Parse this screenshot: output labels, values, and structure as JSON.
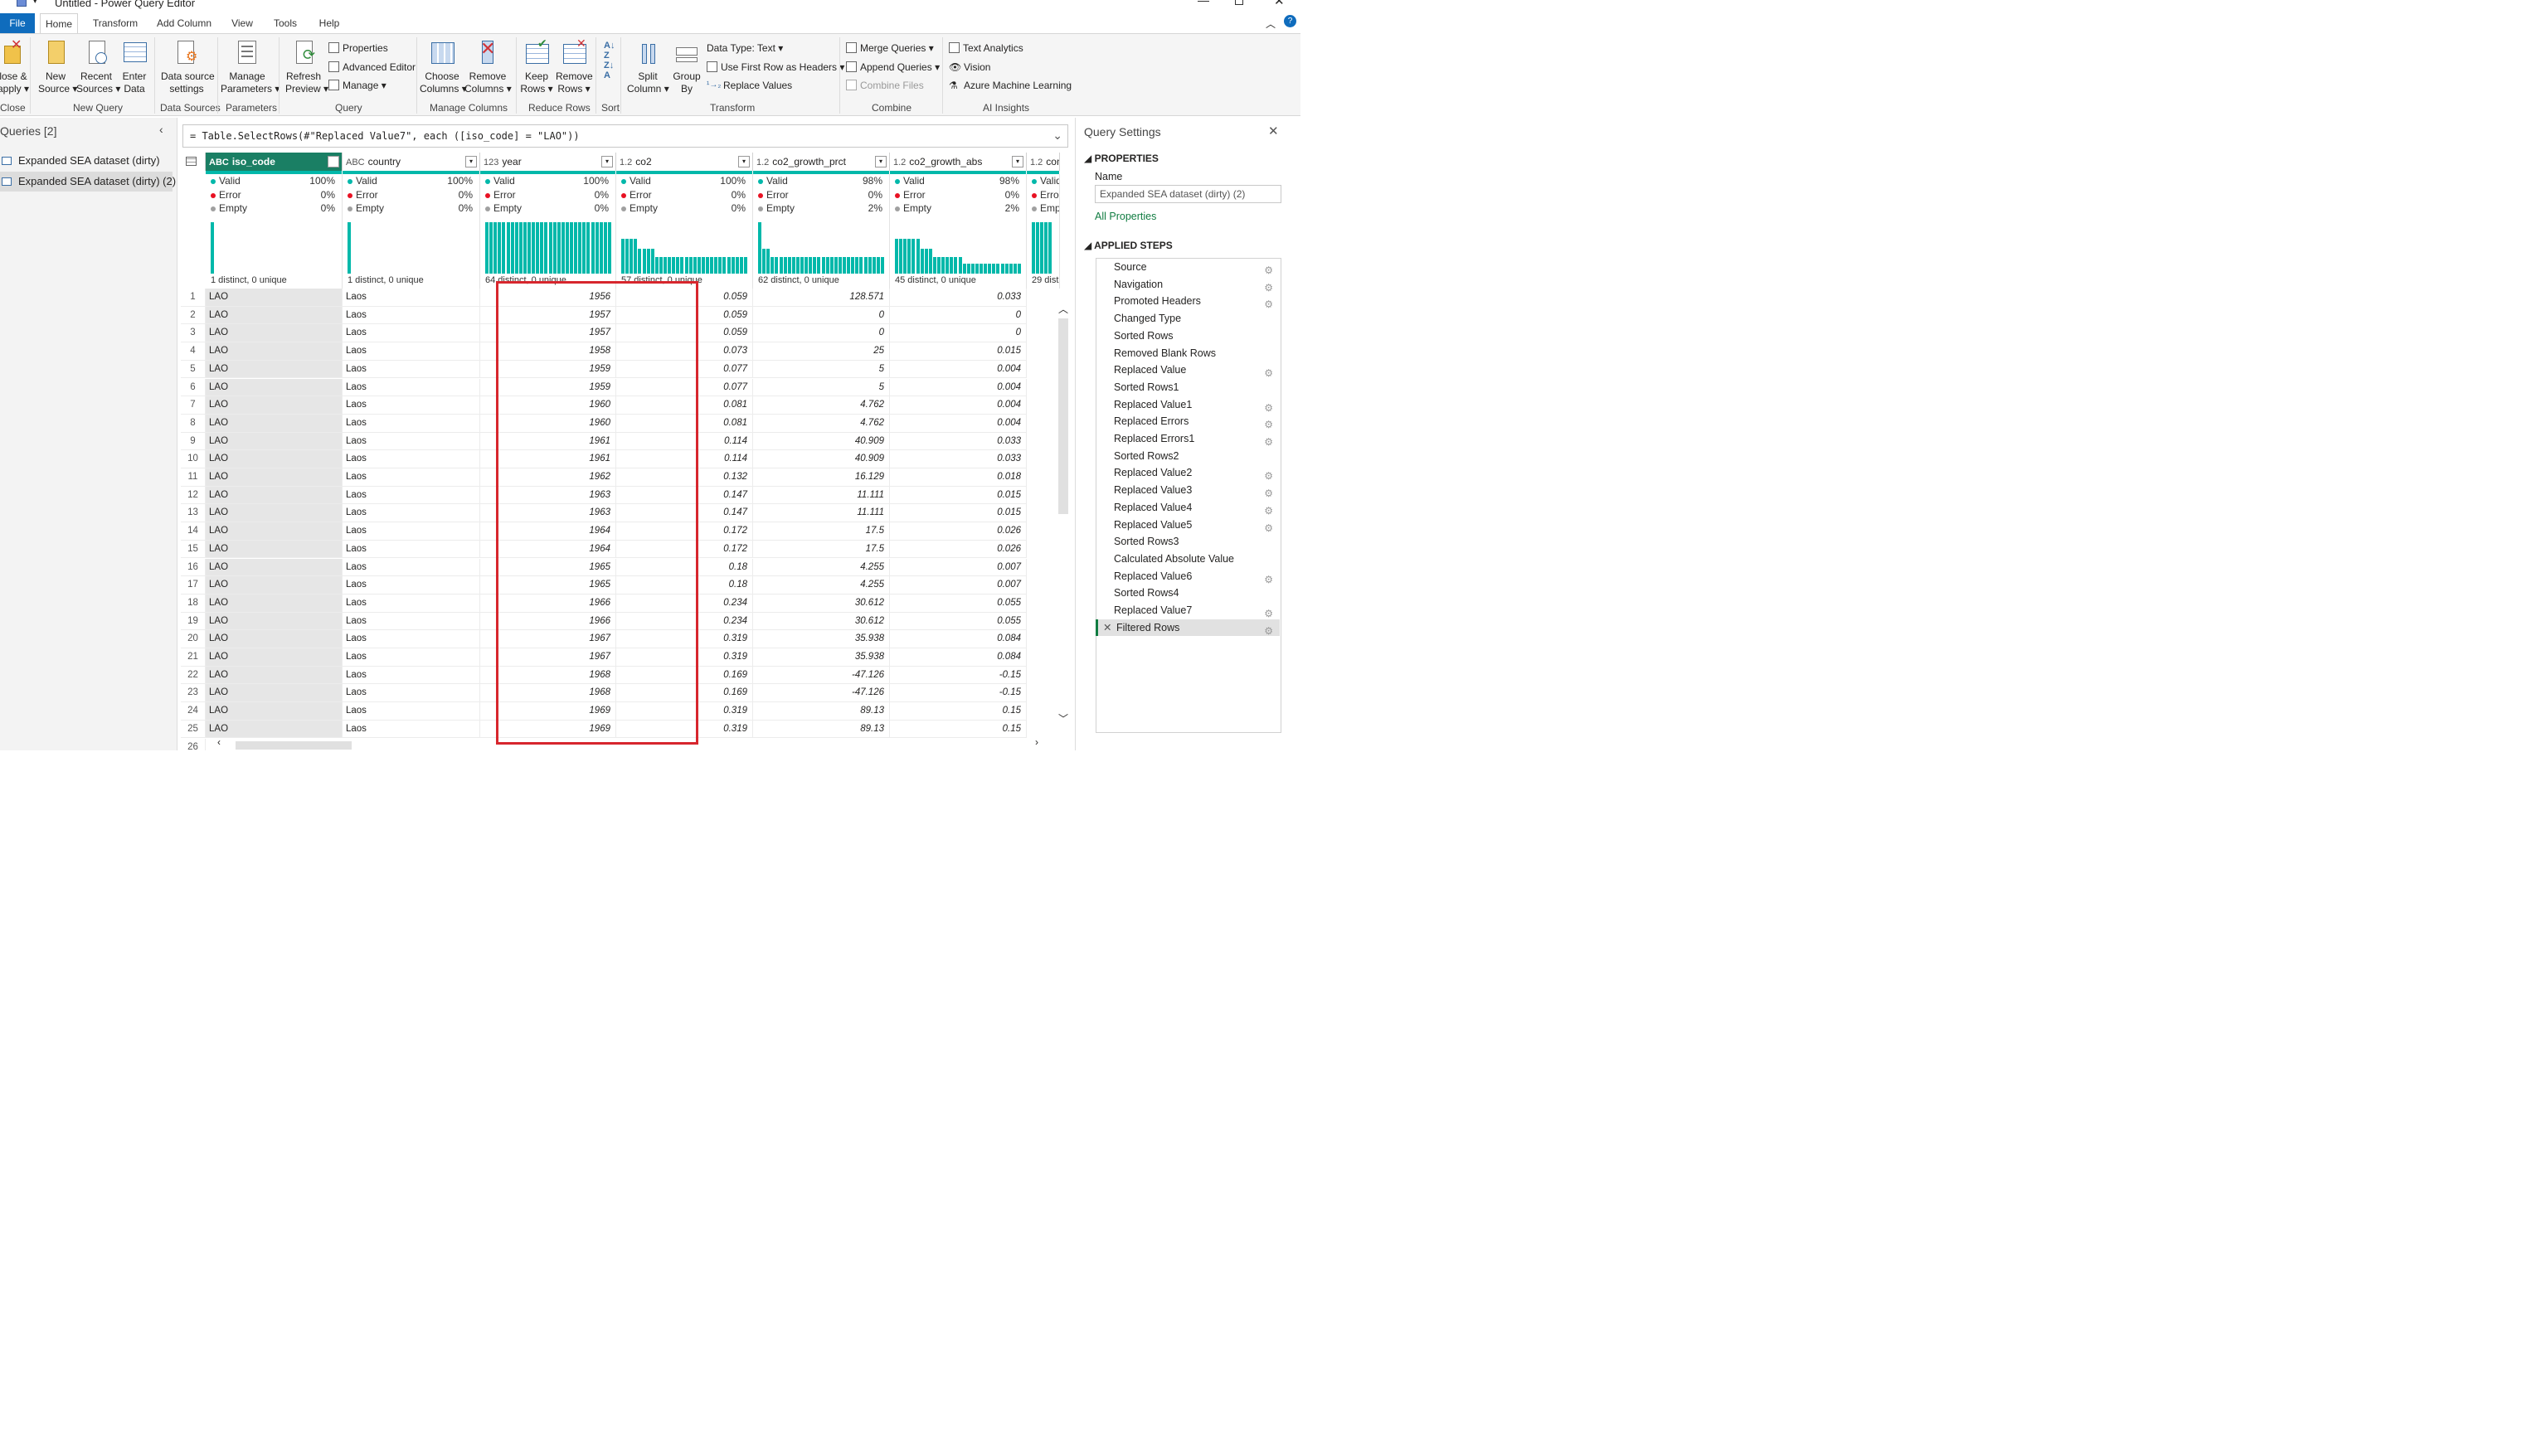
{
  "window": {
    "title": "Untitled - Power Query Editor"
  },
  "tabs": [
    "File",
    "Home",
    "Transform",
    "Add Column",
    "View",
    "Tools",
    "Help"
  ],
  "ribbon": {
    "close": {
      "buttons": [
        {
          "label": "lose &",
          "label2": "apply"
        }
      ],
      "group": "Close"
    },
    "new_query": {
      "buttons": [
        {
          "label": "New",
          "label2": "Source"
        },
        {
          "label": "Recent",
          "label2": "Sources"
        },
        {
          "label": "Enter",
          "label2": "Data"
        }
      ],
      "group": "New Query"
    },
    "data_sources": {
      "buttons": [
        {
          "label": "Data source",
          "label2": "settings"
        }
      ],
      "group": "Data Sources"
    },
    "parameters": {
      "buttons": [
        {
          "label": "Manage",
          "label2": "Parameters"
        }
      ],
      "group": "Parameters"
    },
    "query": {
      "buttons": [
        {
          "label": "Refresh",
          "label2": "Preview"
        }
      ],
      "small": [
        "Properties",
        "Advanced Editor",
        "Manage"
      ],
      "group": "Query"
    },
    "manage_columns": {
      "buttons": [
        {
          "label": "Choose",
          "label2": "Columns"
        },
        {
          "label": "Remove",
          "label2": "Columns"
        }
      ],
      "group": "Manage Columns"
    },
    "reduce_rows": {
      "buttons": [
        {
          "label": "Keep",
          "label2": "Rows"
        },
        {
          "label": "Remove",
          "label2": "Rows"
        }
      ],
      "group": "Reduce Rows"
    },
    "sort": {
      "group": "Sort"
    },
    "transform": {
      "buttons": [
        {
          "label": "Split",
          "label2": "Column"
        },
        {
          "label": "Group",
          "label2": "By"
        }
      ],
      "small": [
        "Data Type: Text",
        "Use First Row as Headers",
        "Replace Values"
      ],
      "group": "Transform"
    },
    "combine": {
      "small": [
        "Merge Queries",
        "Append Queries",
        "Combine Files"
      ],
      "group": "Combine"
    },
    "ai": {
      "small": [
        "Text Analytics",
        "Vision",
        "Azure Machine Learning"
      ],
      "group": "AI Insights"
    }
  },
  "queries": {
    "header": "Queries [2]",
    "items": [
      "Expanded SEA dataset (dirty)",
      "Expanded SEA dataset (dirty) (2)"
    ]
  },
  "formula": {
    "fx": "fx",
    "text": "= Table.SelectRows(#\"Replaced Value7\", each ([iso_code] = \"LAO\"))"
  },
  "columns": [
    {
      "type": "ABC",
      "name": "iso_code",
      "valid": "100%",
      "error": "0%",
      "empty": "0%",
      "distinct": "1 distinct, 0 unique"
    },
    {
      "type": "ABC",
      "name": "country",
      "valid": "100%",
      "error": "0%",
      "empty": "0%",
      "distinct": "1 distinct, 0 unique"
    },
    {
      "type": "123",
      "name": "year",
      "valid": "100%",
      "error": "0%",
      "empty": "0%",
      "distinct": "64 distinct, 0 unique"
    },
    {
      "type": "1.2",
      "name": "co2",
      "valid": "100%",
      "error": "0%",
      "empty": "0%",
      "distinct": "57 distinct, 0 unique"
    },
    {
      "type": "1.2",
      "name": "co2_growth_prct",
      "valid": "98%",
      "error": "0%",
      "empty": "2%",
      "distinct": "62 distinct, 0 unique"
    },
    {
      "type": "1.2",
      "name": "co2_growth_abs",
      "valid": "98%",
      "error": "0%",
      "empty": "2%",
      "distinct": "45 distinct, 0 unique"
    },
    {
      "type": "1.2",
      "name": "consu",
      "valid": "",
      "error": "",
      "empty": "",
      "distinct": "29 distinc"
    }
  ],
  "labels": {
    "valid": "Valid",
    "error": "Error",
    "empty": "Empty"
  },
  "rows": [
    [
      "LAO",
      "Laos",
      "1956",
      "0.059",
      "128.571",
      "0.033"
    ],
    [
      "LAO",
      "Laos",
      "1957",
      "0.059",
      "0",
      "0"
    ],
    [
      "LAO",
      "Laos",
      "1957",
      "0.059",
      "0",
      "0"
    ],
    [
      "LAO",
      "Laos",
      "1958",
      "0.073",
      "25",
      "0.015"
    ],
    [
      "LAO",
      "Laos",
      "1959",
      "0.077",
      "5",
      "0.004"
    ],
    [
      "LAO",
      "Laos",
      "1959",
      "0.077",
      "5",
      "0.004"
    ],
    [
      "LAO",
      "Laos",
      "1960",
      "0.081",
      "4.762",
      "0.004"
    ],
    [
      "LAO",
      "Laos",
      "1960",
      "0.081",
      "4.762",
      "0.004"
    ],
    [
      "LAO",
      "Laos",
      "1961",
      "0.114",
      "40.909",
      "0.033"
    ],
    [
      "LAO",
      "Laos",
      "1961",
      "0.114",
      "40.909",
      "0.033"
    ],
    [
      "LAO",
      "Laos",
      "1962",
      "0.132",
      "16.129",
      "0.018"
    ],
    [
      "LAO",
      "Laos",
      "1963",
      "0.147",
      "11.111",
      "0.015"
    ],
    [
      "LAO",
      "Laos",
      "1963",
      "0.147",
      "11.111",
      "0.015"
    ],
    [
      "LAO",
      "Laos",
      "1964",
      "0.172",
      "17.5",
      "0.026"
    ],
    [
      "LAO",
      "Laos",
      "1964",
      "0.172",
      "17.5",
      "0.026"
    ],
    [
      "LAO",
      "Laos",
      "1965",
      "0.18",
      "4.255",
      "0.007"
    ],
    [
      "LAO",
      "Laos",
      "1965",
      "0.18",
      "4.255",
      "0.007"
    ],
    [
      "LAO",
      "Laos",
      "1966",
      "0.234",
      "30.612",
      "0.055"
    ],
    [
      "LAO",
      "Laos",
      "1966",
      "0.234",
      "30.612",
      "0.055"
    ],
    [
      "LAO",
      "Laos",
      "1967",
      "0.319",
      "35.938",
      "0.084"
    ],
    [
      "LAO",
      "Laos",
      "1967",
      "0.319",
      "35.938",
      "0.084"
    ],
    [
      "LAO",
      "Laos",
      "1968",
      "0.169",
      "-47.126",
      "-0.15"
    ],
    [
      "LAO",
      "Laos",
      "1968",
      "0.169",
      "-47.126",
      "-0.15"
    ],
    [
      "LAO",
      "Laos",
      "1969",
      "0.319",
      "89.13",
      "0.15"
    ],
    [
      "LAO",
      "Laos",
      "1969",
      "0.319",
      "89.13",
      "0.15"
    ]
  ],
  "last_row_number": "26",
  "settings": {
    "title": "Query Settings",
    "properties": "PROPERTIES",
    "name_label": "Name",
    "name_value": "Expanded SEA dataset (dirty) (2)",
    "all_properties": "All Properties",
    "applied_steps": "APPLIED STEPS",
    "steps": [
      {
        "name": "Source",
        "gear": true
      },
      {
        "name": "Navigation",
        "gear": true
      },
      {
        "name": "Promoted Headers",
        "gear": true
      },
      {
        "name": "Changed Type",
        "gear": false
      },
      {
        "name": "Sorted Rows",
        "gear": false
      },
      {
        "name": "Removed Blank Rows",
        "gear": false
      },
      {
        "name": "Replaced Value",
        "gear": true
      },
      {
        "name": "Sorted Rows1",
        "gear": false
      },
      {
        "name": "Replaced Value1",
        "gear": true
      },
      {
        "name": "Replaced Errors",
        "gear": true
      },
      {
        "name": "Replaced Errors1",
        "gear": true
      },
      {
        "name": "Sorted Rows2",
        "gear": false
      },
      {
        "name": "Replaced Value2",
        "gear": true
      },
      {
        "name": "Replaced Value3",
        "gear": true
      },
      {
        "name": "Replaced Value4",
        "gear": true
      },
      {
        "name": "Replaced Value5",
        "gear": true
      },
      {
        "name": "Sorted Rows3",
        "gear": false
      },
      {
        "name": "Calculated Absolute Value",
        "gear": false
      },
      {
        "name": "Replaced Value6",
        "gear": true
      },
      {
        "name": "Sorted Rows4",
        "gear": false
      },
      {
        "name": "Replaced Value7",
        "gear": true
      },
      {
        "name": "Filtered Rows",
        "gear": true
      }
    ]
  }
}
